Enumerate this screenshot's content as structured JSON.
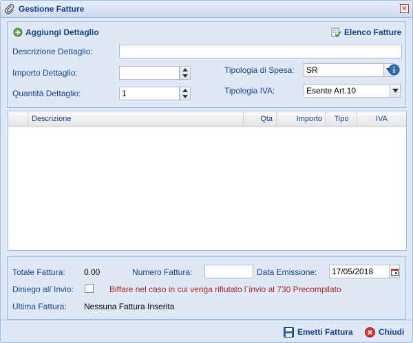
{
  "window": {
    "title": "Gestione Fatture"
  },
  "toolbar": {
    "add_label": "Aggiungi Dettaglio",
    "list_label": "Elenco Fatture"
  },
  "form": {
    "descrizione_label": "Descrizione Dettaglio:",
    "descrizione_value": "",
    "importo_label": "Importo Dettaglio:",
    "importo_value": "",
    "quantita_label": "Quantità Dettaglio:",
    "quantita_value": "1",
    "tipologia_spesa_label": "Tipologia di Spesa:",
    "tipologia_spesa_value": "SR",
    "tipologia_iva_label": "Tipologia IVA:",
    "tipologia_iva_value": "Esente Art.10"
  },
  "grid": {
    "columns": [
      "Descrizione",
      "Qta",
      "Importo",
      "Tipo",
      "IVA"
    ],
    "rows": []
  },
  "footer": {
    "totale_label": "Totale Fattura:",
    "totale_value": "0.00",
    "numero_label": "Numero Fattura:",
    "numero_value": "",
    "data_label": "Data Emissione:",
    "data_value": "17/05/2018",
    "diniego_label": "Diniego all´Invio:",
    "diniego_note": "Biffare nel caso in cui venga rifiutato l´invio al 730 Precompilato",
    "ultima_label": "Ultima Fattura:",
    "ultima_value": "Nessuna Fattura Inserita"
  },
  "buttons": {
    "emetti_label": "Emetti Fattura",
    "chiudi_label": "Chiudi"
  },
  "colors": {
    "accent": "#15428b",
    "panel_bg": "#dfe8f6",
    "border": "#99bbe8",
    "warning": "#b22222"
  }
}
